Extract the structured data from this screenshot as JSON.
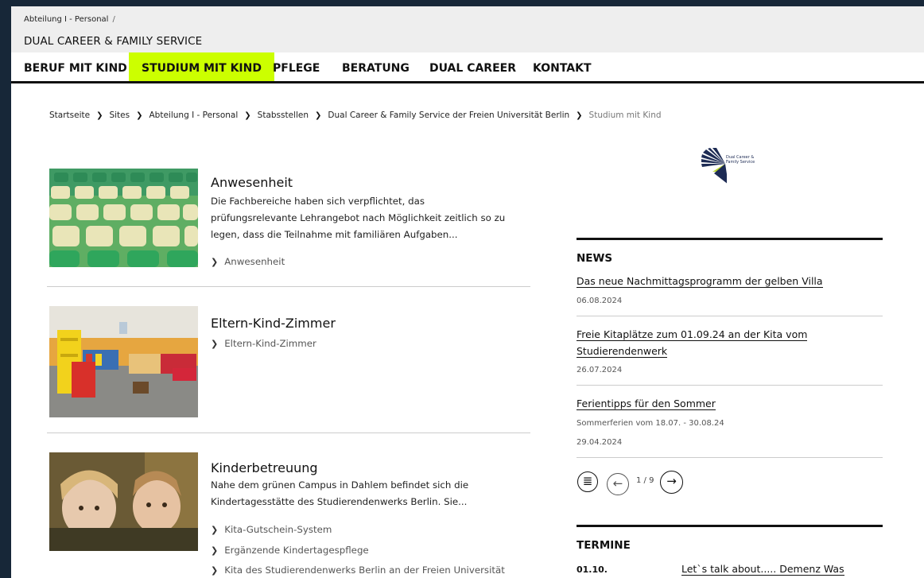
{
  "header": {
    "breadcrumb_top": "Abteilung I - Personal",
    "breadcrumb_sep": "/",
    "site_title": "DUAL CAREER & FAMILY SERVICE"
  },
  "nav": {
    "items": [
      {
        "label": "BERUF MIT KIND"
      },
      {
        "label": "STUDIUM MIT KIND",
        "active": true
      },
      {
        "label": "PFLEGE"
      },
      {
        "label": "BERATUNG"
      },
      {
        "label": "DUAL CAREER"
      },
      {
        "label": "KONTAKT"
      }
    ],
    "active_color": "#ccff00"
  },
  "breadcrumb": [
    "Startseite",
    "Sites",
    "Abteilung I - Personal",
    "Stabsstellen",
    "Dual Career & Family Service der Freien Universität Berlin",
    "Studium mit Kind"
  ],
  "teasers": [
    {
      "title": "Anwesenheit",
      "desc": "Die Fachbereiche haben sich verpflichtet, das prüfungsrelevante Lehrangebot nach Möglichkeit zeitlich so zu legen, dass die Teilnahme mit familiären Aufgaben...",
      "links": [
        "Anwesenheit"
      ]
    },
    {
      "title": "Eltern-Kind-Zimmer",
      "desc": "",
      "links": [
        "Eltern-Kind-Zimmer"
      ]
    },
    {
      "title": "Kinderbetreuung",
      "desc": "Nahe dem grünen Campus in Dahlem befindet sich die Kindertagesstätte des Studierendenwerks Berlin. Sie...",
      "links": [
        "Kita-Gutschein-System",
        "Ergänzende Kindertagespflege",
        "Kita des Studierendenwerks Berlin an der Freien Universität"
      ]
    }
  ],
  "logo": {
    "line1": "Dual Career &",
    "line2": "Family Service"
  },
  "news": {
    "heading": "NEWS",
    "items": [
      {
        "title": "Das neue Nachmittagsprogramm der gelben Villa",
        "date": "06.08.2024"
      },
      {
        "title": "Freie Kitaplätze zum 01.09.24 an der Kita vom Studierendenwerk",
        "date": "26.07.2024"
      },
      {
        "title": "Ferientipps für den Sommer",
        "subtitle": "Sommerferien vom 18.07. - 30.08.24",
        "date": "29.04.2024"
      }
    ],
    "pager": "1 / 9"
  },
  "termine": {
    "heading": "TERMINE",
    "items": [
      {
        "date": "01.10.",
        "title": "Let`s talk about..... Demenz Was"
      }
    ]
  }
}
